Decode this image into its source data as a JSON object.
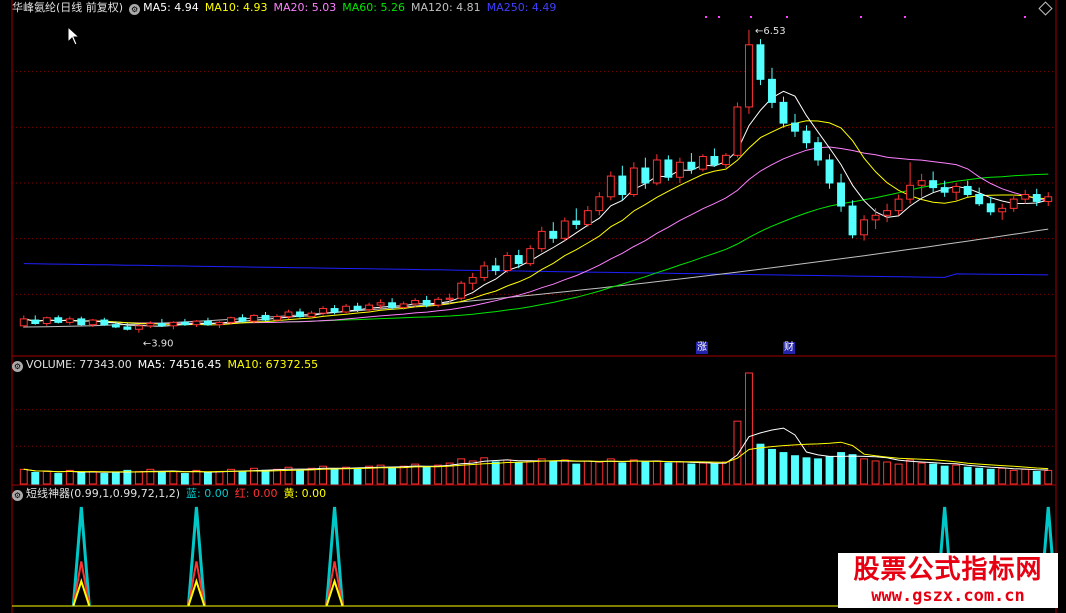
{
  "header_main": {
    "title": "华峰氨纶(日线 前复权)",
    "ma5": "MA5: 4.94",
    "ma10": "MA10: 4.93",
    "ma20": "MA20: 5.03",
    "ma60": "MA60: 5.26",
    "ma120": "MA120: 4.81",
    "ma250": "MA250: 4.49"
  },
  "header_volume": {
    "title": "VOLUME: 77343.00",
    "ma5": "MA5: 74516.45",
    "ma10": "MA10: 67372.55"
  },
  "header_indicator": {
    "title": "短线神器(0.99,1,0.99,72,1,2)",
    "blue": "蓝: 0.00",
    "red": "红: 0.00",
    "yellow": "黄: 0.00"
  },
  "annotations": {
    "high_label": "6.53",
    "low_label": "3.90",
    "tag_zhangting": "涨",
    "tag_cai": "财"
  },
  "watermark": {
    "title": "股票公式指标网",
    "url": "www.gszx.com.cn"
  },
  "colors": {
    "up": "#ff3232",
    "down": "#54ffff",
    "ma5": "#ffffff",
    "ma10": "#ffff00",
    "ma20": "#ff80ff",
    "ma60": "#00e600",
    "ma120": "#c0c0c0",
    "ma250": "#2020ff",
    "separator": "#a00000",
    "grid": "#800000",
    "signal_blue": "#00c8c8",
    "signal_red": "#ff3232",
    "signal_yellow": "#ffff00"
  },
  "chart_data": {
    "type": "candlestick",
    "title": "华峰氨纶(日线 前复权)",
    "ylim": [
      3.75,
      6.65
    ],
    "high_marker": 6.53,
    "low_marker": 3.9,
    "candles": [
      [
        3.96,
        4.05,
        3.94,
        4.02
      ],
      [
        4.01,
        4.05,
        3.97,
        3.98
      ],
      [
        3.98,
        4.04,
        3.96,
        4.03
      ],
      [
        4.03,
        4.05,
        3.98,
        3.99
      ],
      [
        3.99,
        4.04,
        3.97,
        4.02
      ],
      [
        4.02,
        4.04,
        3.96,
        3.97
      ],
      [
        3.97,
        4.02,
        3.95,
        4.01
      ],
      [
        4.01,
        4.03,
        3.96,
        3.97
      ],
      [
        3.97,
        4.0,
        3.94,
        3.95
      ],
      [
        3.95,
        3.99,
        3.92,
        3.93
      ],
      [
        3.93,
        3.97,
        3.9,
        3.96
      ],
      [
        3.96,
        4.0,
        3.94,
        3.98
      ],
      [
        3.98,
        4.02,
        3.95,
        3.96
      ],
      [
        3.96,
        4.0,
        3.93,
        3.99
      ],
      [
        3.99,
        4.02,
        3.96,
        3.97
      ],
      [
        3.97,
        4.01,
        3.95,
        4.0
      ],
      [
        4.0,
        4.03,
        3.96,
        3.97
      ],
      [
        3.97,
        4.0,
        3.94,
        3.99
      ],
      [
        3.99,
        4.04,
        3.97,
        4.03
      ],
      [
        4.03,
        4.06,
        3.99,
        4.0
      ],
      [
        4.0,
        4.06,
        3.98,
        4.05
      ],
      [
        4.05,
        4.08,
        4.0,
        4.01
      ],
      [
        4.01,
        4.06,
        3.99,
        4.04
      ],
      [
        4.04,
        4.1,
        4.02,
        4.08
      ],
      [
        4.08,
        4.11,
        4.03,
        4.04
      ],
      [
        4.04,
        4.09,
        4.02,
        4.07
      ],
      [
        4.07,
        4.13,
        4.05,
        4.11
      ],
      [
        4.11,
        4.14,
        4.06,
        4.08
      ],
      [
        4.08,
        4.15,
        4.07,
        4.13
      ],
      [
        4.13,
        4.16,
        4.08,
        4.1
      ],
      [
        4.1,
        4.16,
        4.08,
        4.14
      ],
      [
        4.14,
        4.19,
        4.11,
        4.16
      ],
      [
        4.16,
        4.2,
        4.1,
        4.12
      ],
      [
        4.12,
        4.17,
        4.1,
        4.15
      ],
      [
        4.15,
        4.2,
        4.12,
        4.18
      ],
      [
        4.18,
        4.22,
        4.12,
        4.14
      ],
      [
        4.14,
        4.21,
        4.12,
        4.19
      ],
      [
        4.19,
        4.24,
        4.15,
        4.2
      ],
      [
        4.2,
        4.35,
        4.18,
        4.33
      ],
      [
        4.33,
        4.42,
        4.27,
        4.38
      ],
      [
        4.38,
        4.52,
        4.35,
        4.48
      ],
      [
        4.48,
        4.55,
        4.4,
        4.44
      ],
      [
        4.44,
        4.6,
        4.42,
        4.57
      ],
      [
        4.57,
        4.62,
        4.46,
        4.5
      ],
      [
        4.5,
        4.66,
        4.48,
        4.63
      ],
      [
        4.63,
        4.82,
        4.6,
        4.78
      ],
      [
        4.78,
        4.86,
        4.68,
        4.72
      ],
      [
        4.72,
        4.9,
        4.7,
        4.87
      ],
      [
        4.87,
        4.98,
        4.8,
        4.84
      ],
      [
        4.84,
        5.0,
        4.82,
        4.96
      ],
      [
        4.96,
        5.12,
        4.92,
        5.08
      ],
      [
        5.08,
        5.3,
        5.05,
        5.26
      ],
      [
        5.26,
        5.35,
        5.05,
        5.1
      ],
      [
        5.1,
        5.38,
        5.08,
        5.33
      ],
      [
        5.33,
        5.42,
        5.15,
        5.2
      ],
      [
        5.2,
        5.45,
        5.18,
        5.4
      ],
      [
        5.4,
        5.44,
        5.22,
        5.25
      ],
      [
        5.25,
        5.42,
        5.2,
        5.38
      ],
      [
        5.38,
        5.46,
        5.28,
        5.32
      ],
      [
        5.32,
        5.45,
        5.3,
        5.43
      ],
      [
        5.43,
        5.5,
        5.34,
        5.36
      ],
      [
        5.36,
        5.46,
        5.33,
        5.44
      ],
      [
        5.44,
        5.9,
        5.42,
        5.86
      ],
      [
        5.86,
        6.53,
        5.8,
        6.4
      ],
      [
        6.4,
        6.45,
        6.05,
        6.1
      ],
      [
        6.1,
        6.2,
        5.85,
        5.9
      ],
      [
        5.9,
        5.95,
        5.68,
        5.72
      ],
      [
        5.72,
        5.8,
        5.6,
        5.65
      ],
      [
        5.65,
        5.7,
        5.5,
        5.55
      ],
      [
        5.55,
        5.6,
        5.35,
        5.4
      ],
      [
        5.4,
        5.45,
        5.15,
        5.2
      ],
      [
        5.2,
        5.28,
        4.95,
        5.0
      ],
      [
        5.0,
        5.05,
        4.72,
        4.75
      ],
      [
        4.75,
        4.92,
        4.7,
        4.88
      ],
      [
        4.88,
        4.98,
        4.8,
        4.92
      ],
      [
        4.92,
        5.02,
        4.86,
        4.96
      ],
      [
        4.96,
        5.1,
        4.92,
        5.06
      ],
      [
        5.06,
        5.38,
        5.02,
        5.18
      ],
      [
        5.18,
        5.28,
        5.08,
        5.22
      ],
      [
        5.22,
        5.3,
        5.12,
        5.16
      ],
      [
        5.16,
        5.22,
        5.08,
        5.12
      ],
      [
        5.12,
        5.2,
        5.05,
        5.17
      ],
      [
        5.17,
        5.22,
        5.08,
        5.1
      ],
      [
        5.1,
        5.16,
        5.0,
        5.02
      ],
      [
        5.02,
        5.08,
        4.92,
        4.95
      ],
      [
        4.95,
        5.02,
        4.88,
        4.98
      ],
      [
        4.98,
        5.1,
        4.95,
        5.06
      ],
      [
        5.06,
        5.14,
        5.02,
        5.1
      ],
      [
        5.1,
        5.15,
        5.0,
        5.04
      ],
      [
        5.04,
        5.12,
        5.0,
        5.08
      ]
    ],
    "volume": {
      "ylim": [
        0,
        106000
      ],
      "values": [
        14000,
        11000,
        12000,
        10000,
        13000,
        11000,
        12000,
        10000,
        11000,
        13000,
        12000,
        14000,
        11000,
        12000,
        10000,
        13000,
        11000,
        12000,
        14000,
        12000,
        15000,
        13000,
        14000,
        16000,
        13000,
        15000,
        17000,
        14000,
        16000,
        15000,
        17000,
        18000,
        15000,
        17000,
        19000,
        16000,
        18000,
        20000,
        24000,
        22000,
        25000,
        21000,
        23000,
        20000,
        22000,
        24000,
        21000,
        23000,
        19000,
        22000,
        21000,
        24000,
        20000,
        23000,
        21000,
        22000,
        20000,
        21000,
        19000,
        20000,
        19000,
        21000,
        60000,
        106000,
        38000,
        33000,
        30000,
        27000,
        25000,
        24000,
        26000,
        30000,
        28000,
        24000,
        22000,
        21000,
        19000,
        23000,
        20000,
        19000,
        17000,
        18000,
        16000,
        15000,
        14000,
        15000,
        13000,
        14000,
        12000,
        13000
      ]
    },
    "indicator": {
      "ylim": [
        0,
        1.05
      ],
      "spike_indices": [
        5,
        15,
        27,
        80,
        100
      ],
      "current": {
        "blue": 0.0,
        "red": 0.0,
        "yellow": 0.0
      }
    }
  }
}
